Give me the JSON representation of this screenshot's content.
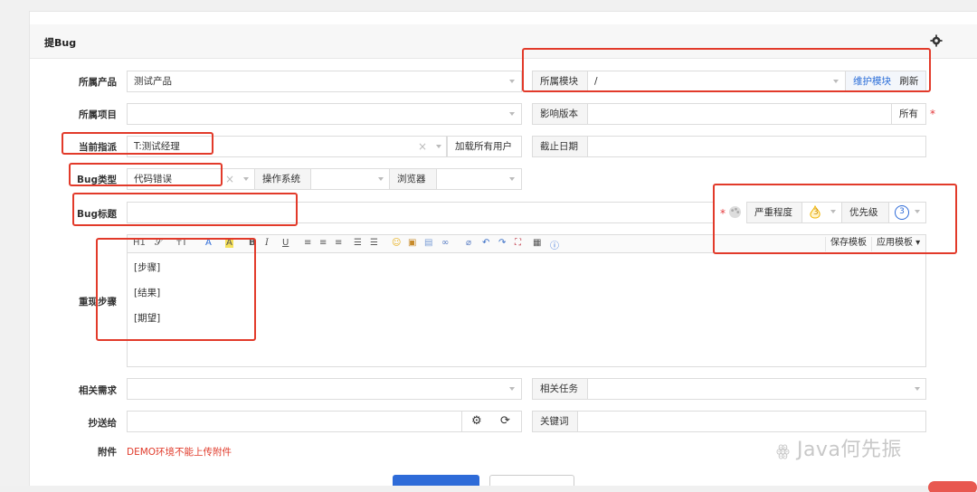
{
  "title": "提Bug",
  "labels": {
    "product": "所属产品",
    "project": "所属项目",
    "assigned": "当前指派",
    "bug_type": "Bug类型",
    "bug_title": "Bug标题",
    "steps": "重现步骤",
    "related_story": "相关需求",
    "cc": "抄送给",
    "attachment": "附件"
  },
  "fields": {
    "product_value": "测试产品",
    "module_label": "所属模块",
    "module_value": "/",
    "maintain_module": "维护模块",
    "refresh": "刷新",
    "affect_version": "影响版本",
    "all": "所有",
    "assigned_value": "T:测试经理",
    "load_all_users": "加载所有用户",
    "deadline": "截止日期",
    "bug_type_value": "代码错误",
    "os": "操作系统",
    "browser": "浏览器",
    "severity": "严重程度",
    "severity_value": "3",
    "priority": "优先级",
    "priority_value": "3",
    "related_task": "相关任务",
    "keywords": "关键词"
  },
  "editor": {
    "toolbar": [
      "H1",
      "𝒮",
      "тT",
      "A",
      "A",
      "B",
      "I",
      "U"
    ],
    "save_template": "保存模板",
    "apply_template": "应用模板",
    "lines": [
      "[步骤]",
      "[结果]",
      "[期望]"
    ]
  },
  "attachment_notice": "DEMO环境不能上传附件",
  "watermark": "Java何先振",
  "colors": {
    "accent": "#2e6bd8",
    "annotation": "#e23a2a",
    "required": "#e4393c"
  }
}
